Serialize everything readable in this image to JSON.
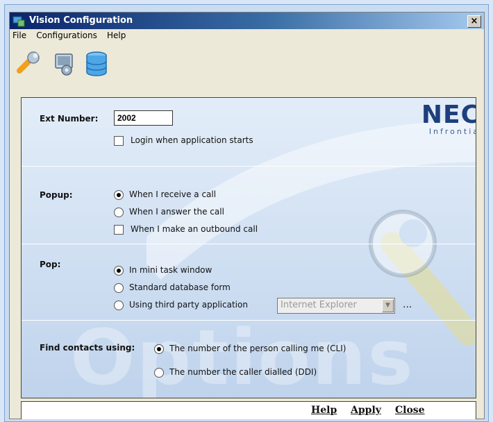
{
  "window": {
    "title": "Vision Configuration",
    "close_glyph": "×"
  },
  "menu": [
    "File",
    "Configurations",
    "Help"
  ],
  "toolbar": {
    "icons": [
      "wrench-icon",
      "settings-monitor-icon",
      "database-icon"
    ]
  },
  "logo": {
    "brand": "NEC",
    "sub": "Infrontia"
  },
  "ext": {
    "label": "Ext Number:",
    "value": "2002",
    "login_option": "Login when application starts",
    "login_checked": false
  },
  "popup": {
    "label": "Popup:",
    "options": [
      {
        "text": "When I receive a call",
        "selected": true
      },
      {
        "text": "When I answer the call",
        "selected": false
      }
    ],
    "outbound": {
      "text": "When I make an outbound call",
      "checked": false
    }
  },
  "pop": {
    "label": "Pop:",
    "options": [
      {
        "text": "In mini task window",
        "selected": true
      },
      {
        "text": "Standard database form",
        "selected": false
      },
      {
        "text": "Using third party application",
        "selected": false
      }
    ],
    "app_select_value": "Internet Explorer",
    "browse_label": "..."
  },
  "find": {
    "label": "Find contacts using:",
    "options": [
      {
        "text": "The number of the person calling me (CLI)",
        "selected": true
      },
      {
        "text": "The number the caller dialled (DDI)",
        "selected": false
      }
    ]
  },
  "watermark": "Options",
  "footer": {
    "help": "Help",
    "apply": "Apply",
    "close": "Close"
  },
  "colors": {
    "titlebar": "#0a246a",
    "panel": "#cfdff2",
    "logo": "#1d3f7c"
  }
}
